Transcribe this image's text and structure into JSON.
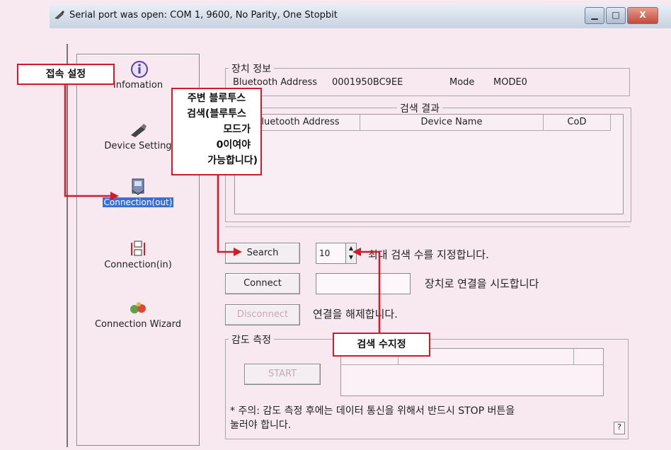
{
  "window": {
    "title": "Serial port was open: COM 1, 9600, No Parity, One Stopbit",
    "minimize": "▁",
    "maximize": "□",
    "close": "X"
  },
  "nav": {
    "items": [
      {
        "label": "Infomation",
        "icon": "info-icon"
      },
      {
        "label": "Device Setting",
        "icon": "device-icon"
      },
      {
        "label": "Connection(out)",
        "icon": "connection-out-icon",
        "selected": true
      },
      {
        "label": "Connection(in)",
        "icon": "connection-in-icon"
      },
      {
        "label": "Connection Wizard",
        "icon": "wizard-icon"
      }
    ]
  },
  "device_info": {
    "group_label": "장치 정보",
    "bt_label": "Bluetooth Address",
    "bt_value": "0001950BC9EE",
    "mode_label": "Mode",
    "mode_value": "MODE0"
  },
  "search_result": {
    "group_label": "검색 결과",
    "columns": [
      "Bluetooth Address",
      "Device Name",
      "CoD"
    ]
  },
  "actions": {
    "search_label": "Search",
    "search_count": "10",
    "search_desc": "최대 검색 수를 지정합니다.",
    "connect_label": "Connect",
    "connect_desc": "장치로 연결을 시도합니다",
    "disconnect_label": "Disconnect",
    "disconnect_desc": "연결을 해제합니다."
  },
  "sensitivity": {
    "group_label": "감도 측정",
    "start_label": "START",
    "note_line1": "* 주의: 감도 측정 후에는 데이터 통신을 위해서 반드시 STOP 버튼을",
    "note_line2": "눌러야 합니다.",
    "help_label": "?"
  },
  "annotations": {
    "connect_setting": "접속 설정",
    "scan_note": [
      "주변 블루투스",
      "검색(블루투스",
      "모드가",
      "0이여야",
      "가능합니다)"
    ],
    "count_note": "검색 수지정"
  },
  "colors": {
    "background": "#f7e9ef",
    "annotation_red": "#d11a2a",
    "selection_blue": "#3a6fd8"
  }
}
